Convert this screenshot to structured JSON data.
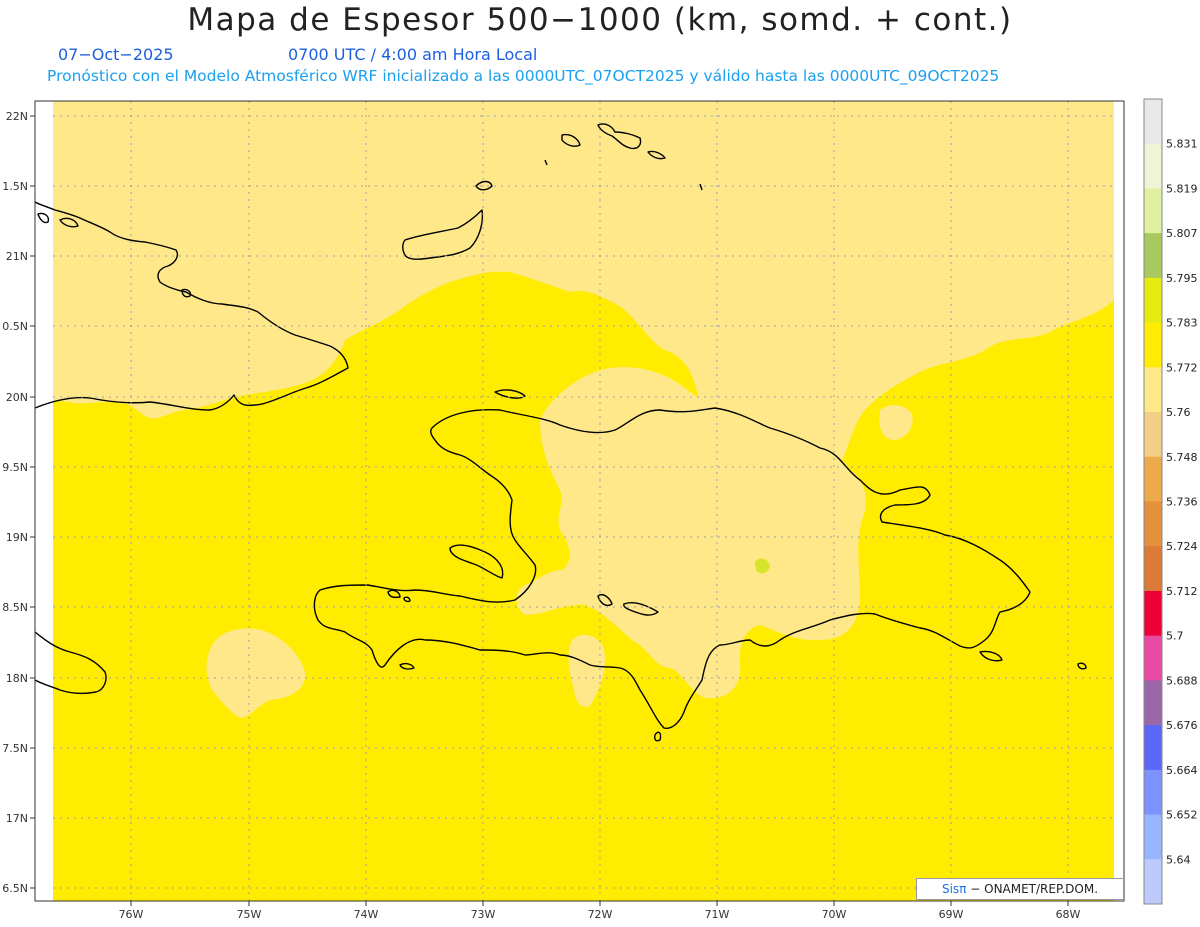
{
  "title": "Mapa de Espesor 500−1000 (km, somd. + cont.)",
  "date": "07−Oct−2025",
  "time": "0700 UTC / 4:00 am Hora Local",
  "forecast": "Pronóstico con el Modelo Atmosférico WRF inicializado a las 0000UTC_07OCT2025 y válido hasta las  0000UTC_09OCT2025",
  "credit_brand": "Sisπ",
  "credit_text": "− ONAMET/REP.DOM.",
  "lat_labels": [
    "22N",
    "1.5N",
    "21N",
    "0.5N",
    "20N",
    "9.5N",
    "19N",
    "8.5N",
    "18N",
    "7.5N",
    "17N",
    "6.5N"
  ],
  "lon_labels": [
    "76W",
    "75W",
    "74W",
    "73W",
    "72W",
    "71W",
    "70W",
    "69W",
    "68W"
  ],
  "colorbar": {
    "labels": [
      "5.831",
      "5.819",
      "5.807",
      "5.795",
      "5.783",
      "5.772",
      "5.76",
      "5.748",
      "5.736",
      "5.724",
      "5.712",
      "5.7",
      "5.688",
      "5.676",
      "5.664",
      "5.652",
      "5.64"
    ],
    "colors": [
      "#e8e8e8",
      "#eef5d4",
      "#dff0a0",
      "#a8c860",
      "#e6ea10",
      "#ffec00",
      "#ffe88a",
      "#f2cf84",
      "#ecaa4a",
      "#e5903c",
      "#dc7a38",
      "#ee0038",
      "#e84aa4",
      "#9a68a8",
      "#5c66f8",
      "#7c92ff",
      "#98b6ff",
      "#bccafc"
    ]
  },
  "colors": {
    "background_field": "#ffec00",
    "low_field": "#ffe88a",
    "high_spot": "#d8e42a",
    "coastline": "#000000",
    "title": "#222222",
    "subtitle_dark": "#1c5fe0",
    "subtitle_light": "#1aa0f0"
  }
}
